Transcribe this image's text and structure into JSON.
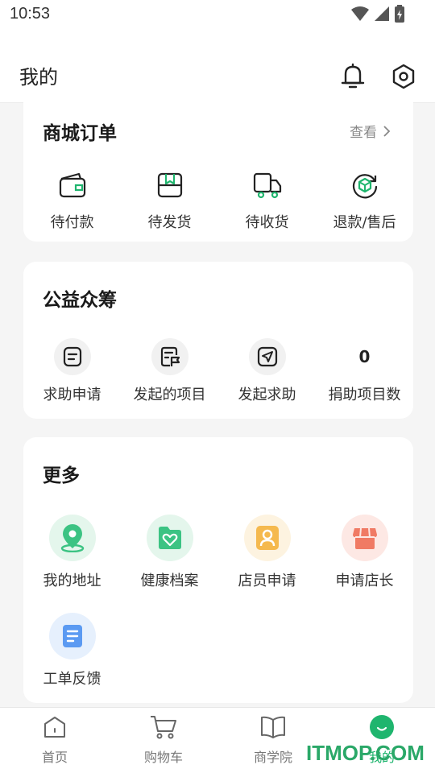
{
  "status_bar": {
    "time": "10:53"
  },
  "header": {
    "title": "我的"
  },
  "orders": {
    "title": "商城订单",
    "view_all": "查看",
    "items": [
      {
        "label": "待付款",
        "icon": "wallet-icon"
      },
      {
        "label": "待发货",
        "icon": "package-icon"
      },
      {
        "label": "待收货",
        "icon": "truck-icon"
      },
      {
        "label": "退款/售后",
        "icon": "refund-icon"
      }
    ]
  },
  "charity": {
    "title": "公益众筹",
    "items": [
      {
        "label": "求助申请",
        "icon": "document-icon"
      },
      {
        "label": "发起的项目",
        "icon": "flag-document-icon"
      },
      {
        "label": "发起求助",
        "icon": "send-icon"
      },
      {
        "label": "捐助项目数",
        "value": "0"
      }
    ]
  },
  "more": {
    "title": "更多",
    "items": [
      {
        "label": "我的地址",
        "icon": "location-pin-icon"
      },
      {
        "label": "健康档案",
        "icon": "health-folder-icon"
      },
      {
        "label": "店员申请",
        "icon": "staff-badge-icon"
      },
      {
        "label": "申请店长",
        "icon": "store-icon"
      },
      {
        "label": "工单反馈",
        "icon": "work-order-icon"
      }
    ]
  },
  "tabbar": {
    "items": [
      {
        "label": "首页",
        "icon": "home-icon"
      },
      {
        "label": "购物车",
        "icon": "cart-icon"
      },
      {
        "label": "商学院",
        "icon": "book-icon"
      },
      {
        "label": "我的",
        "icon": "profile-icon",
        "active": true
      }
    ]
  },
  "watermark": "ITMOP.COM",
  "colors": {
    "accent": "#1fb56e",
    "background": "#f5f5f5",
    "card": "#ffffff"
  }
}
